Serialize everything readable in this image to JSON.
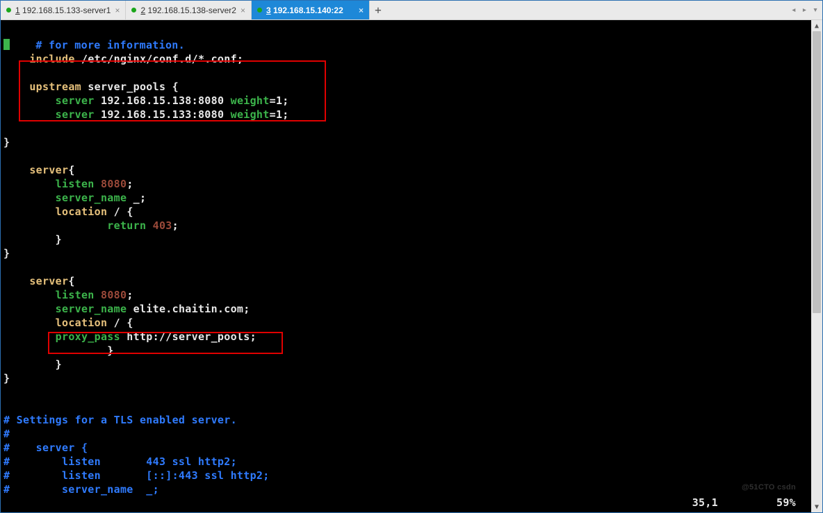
{
  "tabs": [
    {
      "num": "1",
      "label": "192.168.15.133-server1",
      "active": false
    },
    {
      "num": "2",
      "label": "192.168.15.138-server2",
      "active": false
    },
    {
      "num": "3",
      "label": "192.168.15.140:22",
      "active": true
    }
  ],
  "code": {
    "l1_a": "    # for more information.",
    "l2_a": "    ",
    "l2_b": "include",
    "l2_c": " /etc/nginx/conf.d/*.conf;",
    "l4_a": "    ",
    "l4_b": "upstream",
    "l4_c": " server_pools ",
    "l4_d": "{",
    "l5_a": "        ",
    "l5_b": "server",
    "l5_c": " 192.168.15.138:8080 ",
    "l5_d": "weight",
    "l5_e": "=1;",
    "l6_a": "        ",
    "l6_b": "server",
    "l6_c": " 192.168.15.133:8080 ",
    "l6_d": "weight",
    "l6_e": "=1;",
    "l8": "}",
    "l10_a": "    ",
    "l10_b": "server",
    "l10_c": "{",
    "l11_a": "        ",
    "l11_b": "listen",
    "l11_c": " ",
    "l11_d": "8080",
    "l11_e": ";",
    "l12_a": "        ",
    "l12_b": "server_name",
    "l12_c": " _;",
    "l13_a": "        ",
    "l13_b": "location",
    "l13_c": " / ",
    "l13_d": "{",
    "l14_a": "                ",
    "l14_b": "return",
    "l14_c": " ",
    "l14_d": "403",
    "l14_e": ";",
    "l15": "        }",
    "l16": "}",
    "l18_a": "    ",
    "l18_b": "server",
    "l18_c": "{",
    "l19_a": "        ",
    "l19_b": "listen",
    "l19_c": " ",
    "l19_d": "8080",
    "l19_e": ";",
    "l20_a": "        ",
    "l20_b": "server_name",
    "l20_c": " elite.chaitin.com;",
    "l21_a": "        ",
    "l21_b": "location",
    "l21_c": " / ",
    "l21_d": "{",
    "l22_a": "        ",
    "l22_b": "proxy_pass",
    "l22_c": " http://server_pools;",
    "l23": "                }",
    "l24": "        }",
    "l25": "}",
    "l28": "# Settings for a TLS enabled server.",
    "l29": "#",
    "l30": "#    server {",
    "l31": "#        listen       443 ssl http2;",
    "l32": "#        listen       [::]:443 ssl http2;",
    "l33": "#        server_name  _;"
  },
  "status": {
    "pos": "35,1",
    "pct": "59%"
  },
  "watermark": "@51CTO csdn",
  "nav_arrows": "◂ ▸ ▾"
}
